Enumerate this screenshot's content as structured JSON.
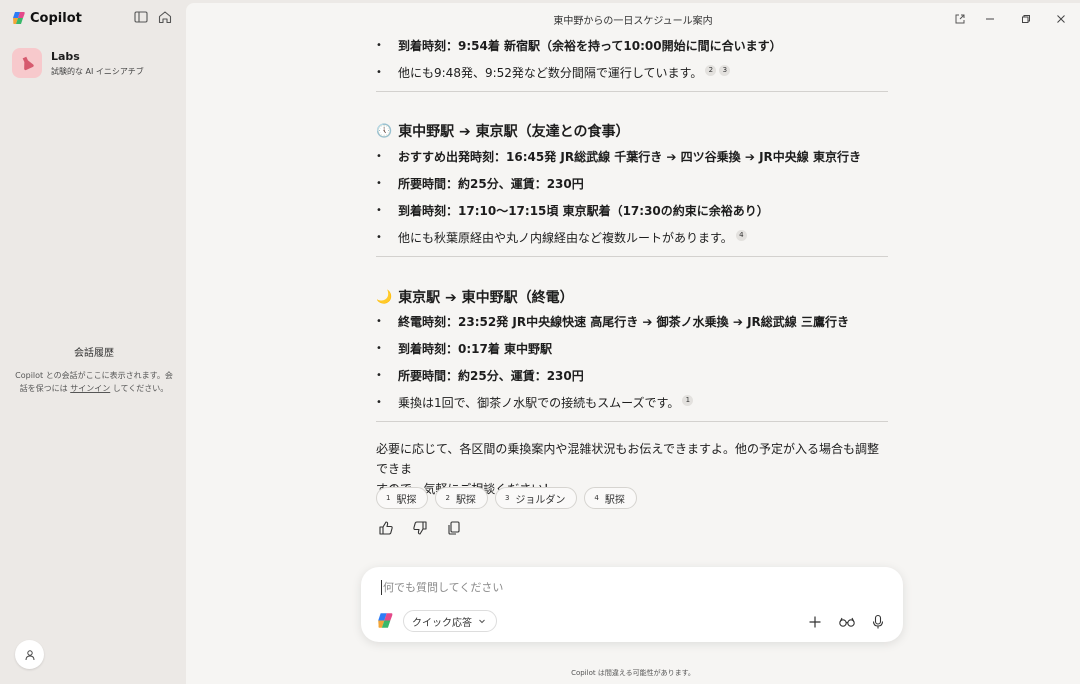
{
  "sidebar": {
    "app_name": "Copilot",
    "labs_title": "Labs",
    "labs_subtitle": "試験的な AI イニシアチブ",
    "history_title": "会話履歴",
    "history_desc_1": "Copilot との会話がここに表示されます。会",
    "history_desc_2": "話を保つには",
    "history_link": "サインイン",
    "history_desc_3": "してください。"
  },
  "window": {
    "title": "東中野からの一日スケジュール案内"
  },
  "section1": {
    "bullets": [
      {
        "text": "到着時刻：9:54着 新宿駅（余裕を持って10:00開始に間に合います）",
        "bold": true,
        "cites": []
      },
      {
        "text": "他にも9:48発、9:52発など数分間隔で運行しています。",
        "bold": false,
        "cites": [
          "2",
          "3"
        ]
      }
    ]
  },
  "section2": {
    "emoji": "🕔",
    "heading": "東中野駅 ➔ 東京駅（友達との食事）",
    "bullets": [
      {
        "text": "おすすめ出発時刻：16:45発 JR総武線 千葉行き ➔ 四ツ谷乗換 ➔ JR中央線 東京行き",
        "bold": true,
        "cites": []
      },
      {
        "text": "所要時間：約25分、運賃：230円",
        "bold": true,
        "cites": []
      },
      {
        "text": "到着時刻：17:10〜17:15頃 東京駅着（17:30の約束に余裕あり）",
        "bold": true,
        "cites": []
      },
      {
        "text": "他にも秋葉原経由や丸ノ内線経由など複数ルートがあります。",
        "bold": false,
        "cites": [
          "4"
        ]
      }
    ]
  },
  "section3": {
    "emoji": "🌙",
    "heading": "東京駅 ➔ 東中野駅（終電）",
    "bullets": [
      {
        "text": "終電時刻：23:52発 JR中央線快速 高尾行き ➔ 御茶ノ水乗換 ➔ JR総武線 三鷹行き",
        "bold": true,
        "cites": []
      },
      {
        "text": "到着時刻：0:17着 東中野駅",
        "bold": true,
        "cites": []
      },
      {
        "text": "所要時間：約25分、運賃：230円",
        "bold": true,
        "cites": []
      },
      {
        "text": "乗換は1回で、御茶ノ水駅での接続もスムーズです。",
        "bold": false,
        "cites": [
          "1"
        ]
      }
    ]
  },
  "closing_line_1": "必要に応じて、各区間の乗換案内や混雑状況もお伝えできますよ。他の予定が入る場合も調整できま",
  "closing_line_2": "すので、気軽にご相談ください！",
  "sources": [
    {
      "num": "1",
      "label": "駅探"
    },
    {
      "num": "2",
      "label": "駅探"
    },
    {
      "num": "3",
      "label": "ジョルダン"
    },
    {
      "num": "4",
      "label": "駅探"
    }
  ],
  "composer": {
    "placeholder": "何でも質問してください",
    "mode_label": "クイック応答"
  },
  "footer": "Copilot は間違える可能性があります。"
}
